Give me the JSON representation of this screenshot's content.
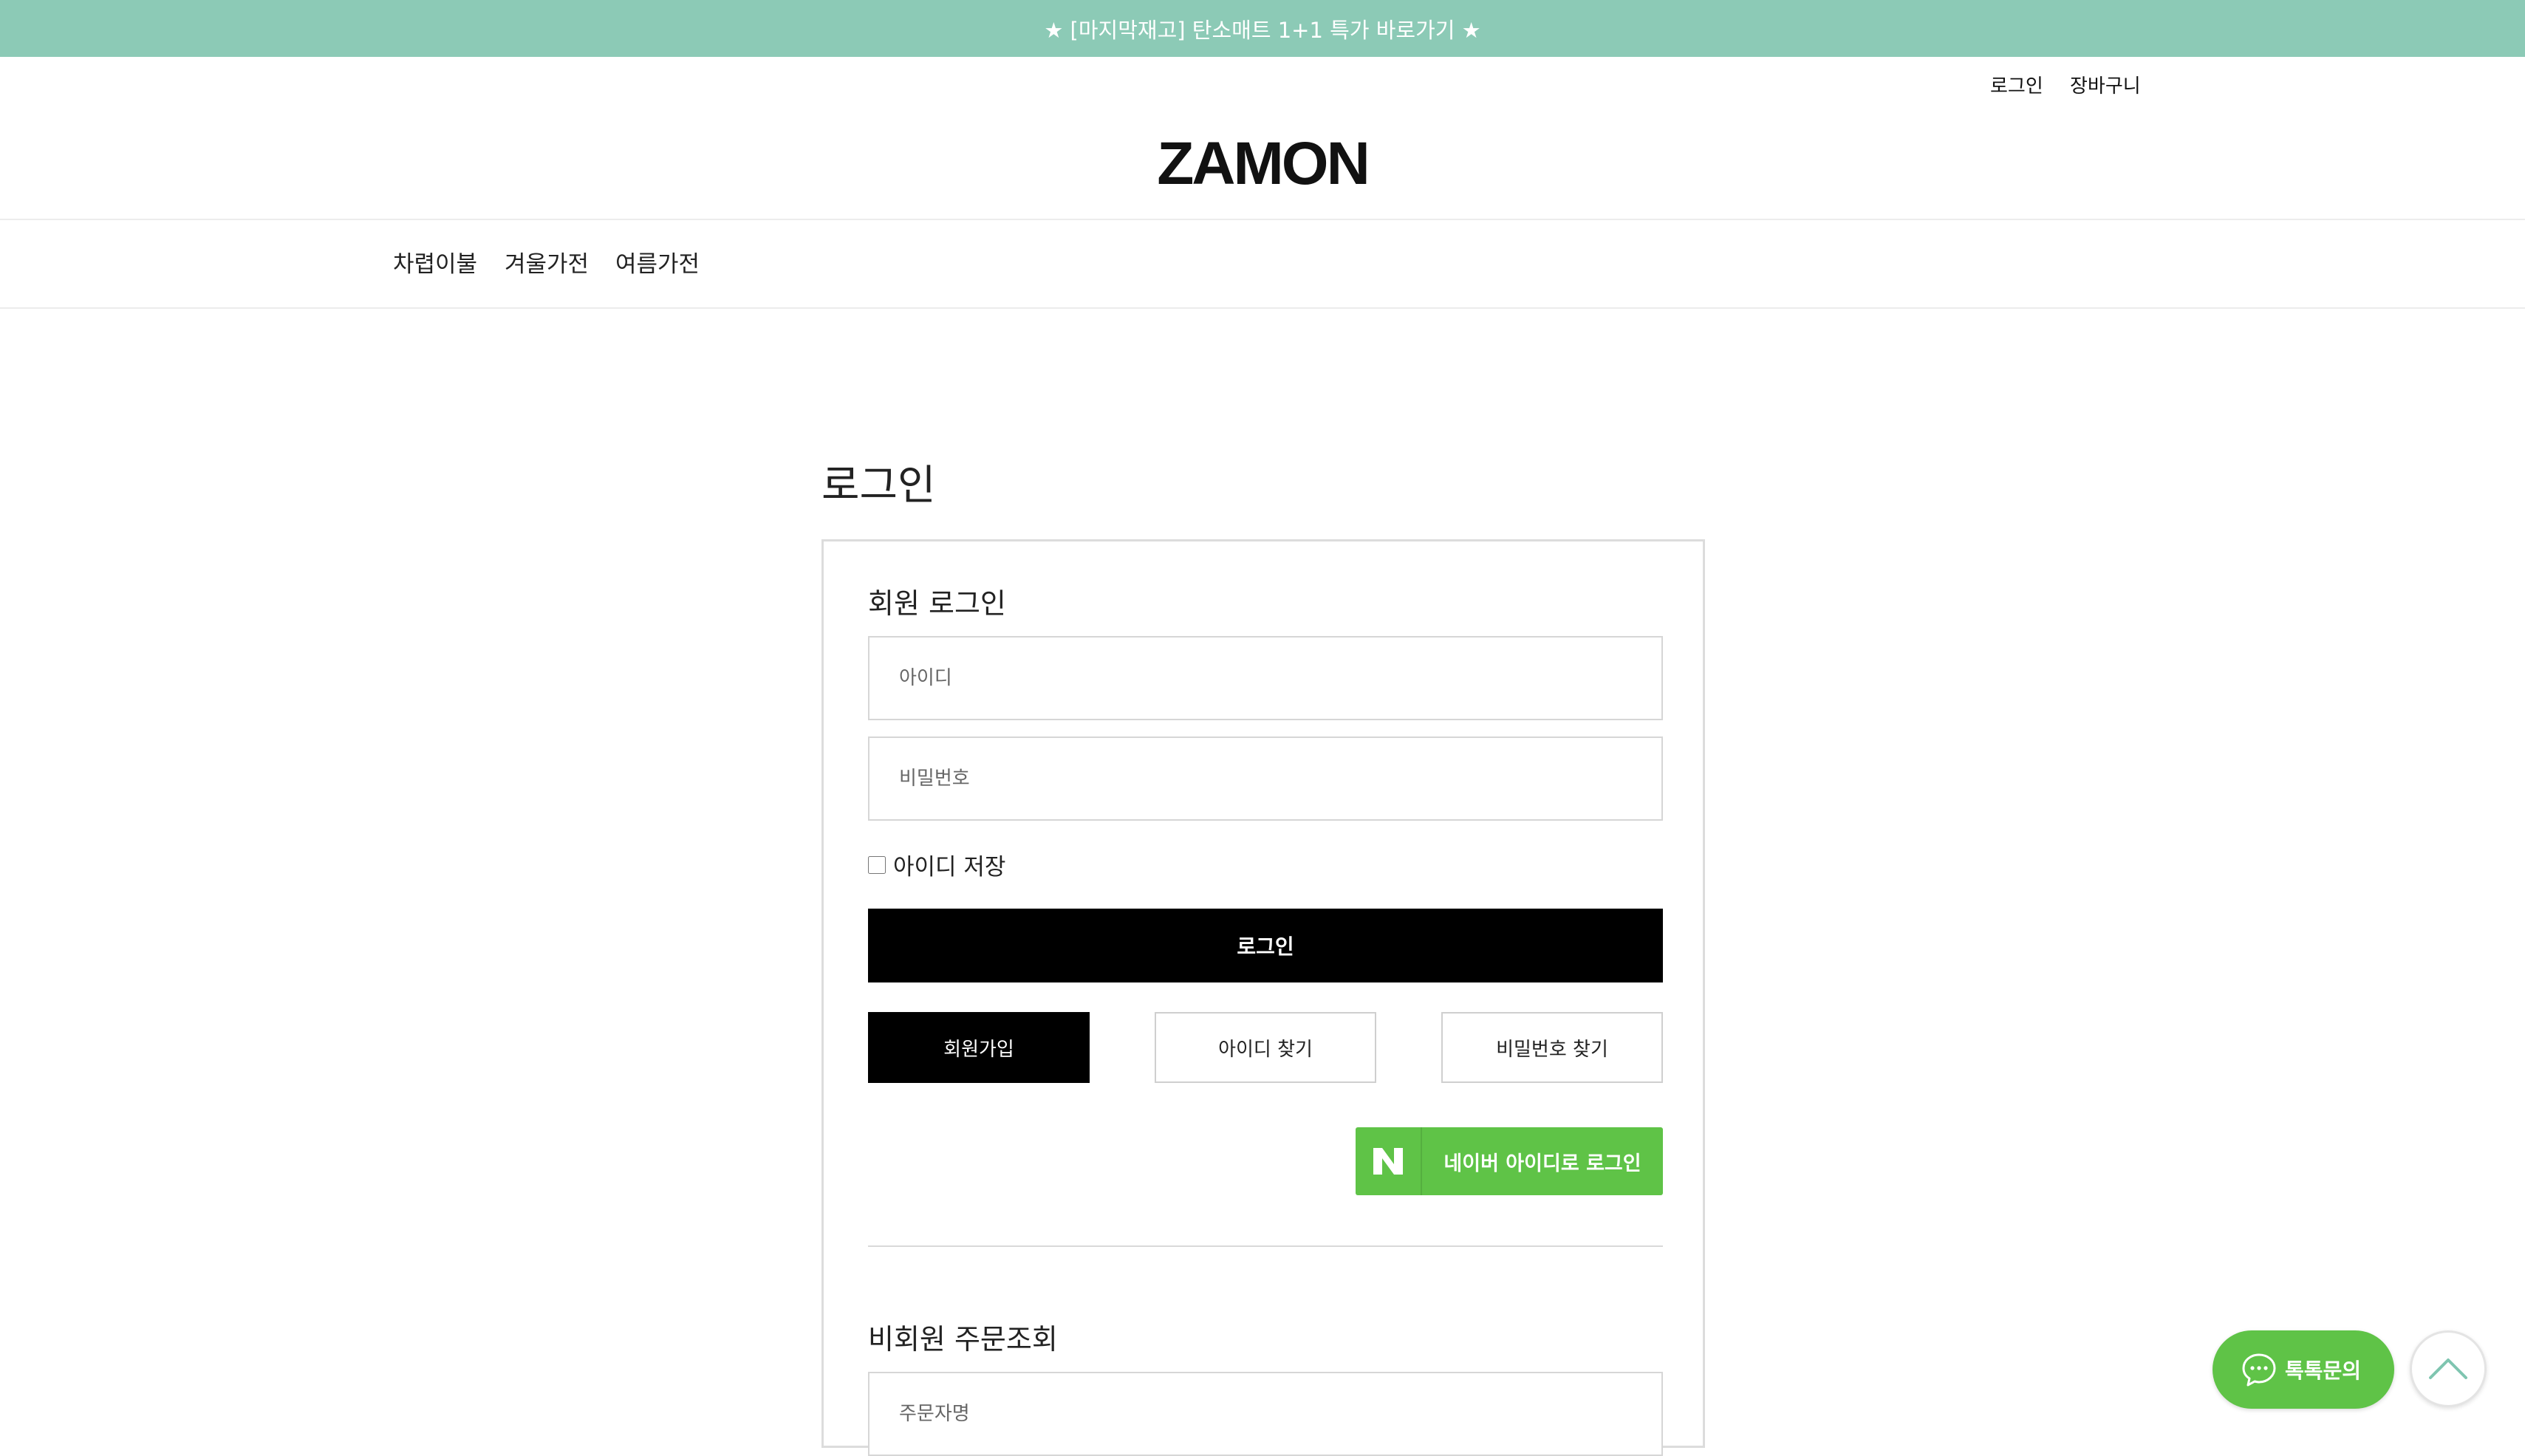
{
  "announcement": {
    "text": "★ [마지막재고] 탄소매트 1+1 특가 바로가기 ★",
    "background": "#8ccab6"
  },
  "header": {
    "links": [
      "로그인",
      "장바구니"
    ],
    "logo": "ZAMON"
  },
  "nav": {
    "items": [
      "차렵이불",
      "겨울가전",
      "여름가전"
    ]
  },
  "page": {
    "title": "로그인"
  },
  "member_login": {
    "title": "회원 로그인",
    "id_placeholder": "아이디",
    "password_placeholder": "비밀번호",
    "remember_label": "아이디 저장",
    "login_button": "로그인",
    "join_button": "회원가입",
    "find_id_button": "아이디 찾기",
    "find_password_button": "비밀번호 찾기",
    "naver_button": "네이버 아이디로 로그인",
    "naver_logo_letter": "N",
    "naver_color": "#5fc347"
  },
  "guest_order": {
    "title": "비회원 주문조회",
    "name_placeholder": "주문자명"
  },
  "floating": {
    "talk_label": "톡톡문의",
    "talk_color": "#5fc347"
  }
}
